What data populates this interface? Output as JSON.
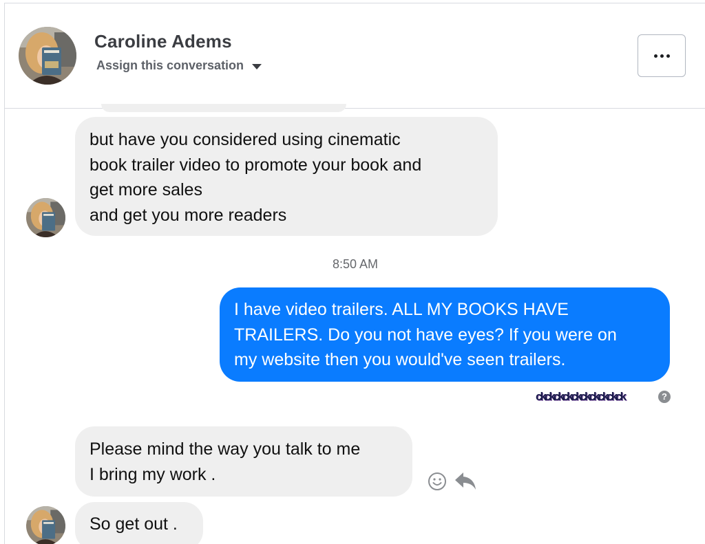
{
  "header": {
    "contact_name": "Caroline Adems",
    "assign_label": "Assign this conversation",
    "more_icon": "more-horizontal-icon"
  },
  "messages": [
    {
      "direction": "incoming",
      "lines": [
        "but have you considered using  cinematic",
        "book trailer video to promote your book and",
        "get more sales",
        "and get you more readers"
      ]
    },
    {
      "direction": "outgoing",
      "lines": [
        "I have video trailers. ALL MY BOOKS HAVE",
        "TRAILERS. Do you not have eyes? If you were on",
        "my website then you would've seen trailers."
      ]
    },
    {
      "direction": "incoming",
      "lines": [
        "Please mind the way you talk to me",
        "I bring my work ."
      ]
    },
    {
      "direction": "incoming",
      "lines": [
        "So get out ."
      ]
    }
  ],
  "timestamp": "8:50 AM",
  "seen_label": "ckckckckckckckckckck",
  "help_icon_glyph": "?",
  "colors": {
    "outgoing_bubble": "#0a7cff",
    "incoming_bubble": "#efefef",
    "timestamp_text": "#65676b"
  },
  "icons": [
    "profile-photo-icon",
    "caret-down-icon",
    "more-horizontal-icon",
    "emoji-react-icon",
    "reply-arrow-icon",
    "help-icon"
  ]
}
